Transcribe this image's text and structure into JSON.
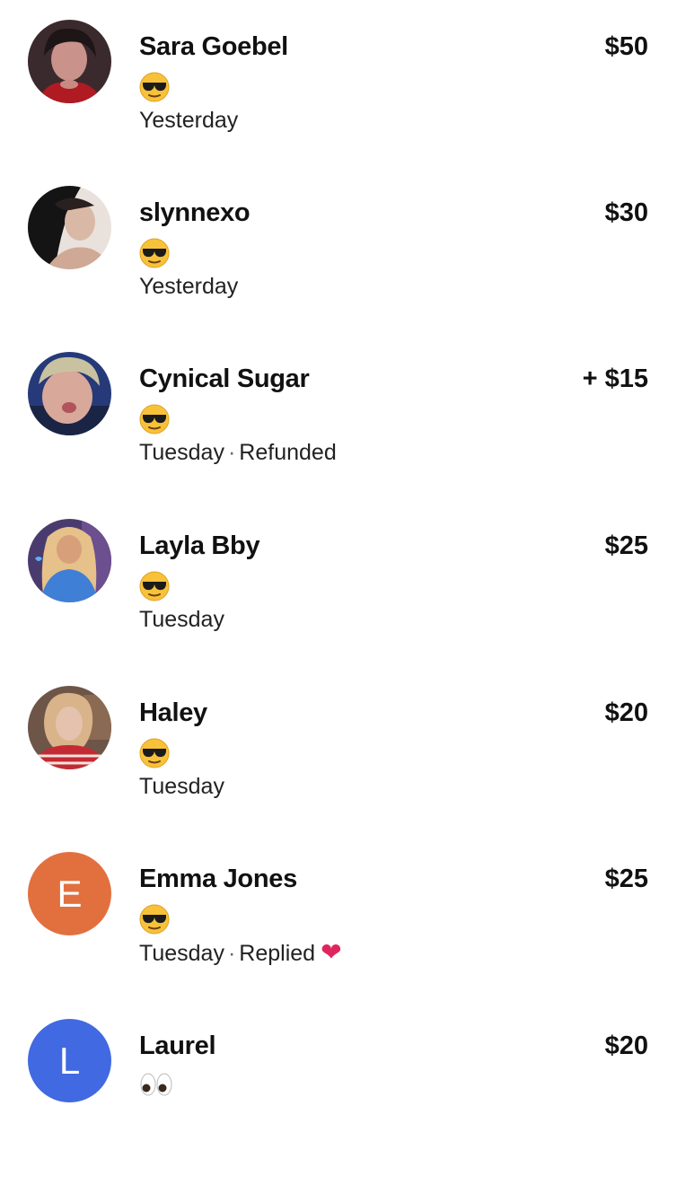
{
  "transactions": [
    {
      "name": "Sara Goebel",
      "emoji": "sunglasses-face-emoji",
      "date": "Yesterday",
      "status": "",
      "amount": "$50",
      "avatar_type": "photo",
      "avatar_colors": [
        "#3a2a2e",
        "#c9928a",
        "#b01a22"
      ]
    },
    {
      "name": "slynnexo",
      "emoji": "sunglasses-face-emoji",
      "date": "Yesterday",
      "status": "",
      "amount": "$30",
      "avatar_type": "photo",
      "avatar_colors": [
        "#141414",
        "#d9b9a6",
        "#2b2020"
      ]
    },
    {
      "name": "Cynical Sugar",
      "emoji": "sunglasses-face-emoji",
      "date": "Tuesday",
      "status": "Refunded",
      "amount": "+ $15",
      "avatar_type": "photo",
      "avatar_colors": [
        "#263a7a",
        "#d8a89a",
        "#c9c2a0"
      ]
    },
    {
      "name": "Layla Bby",
      "emoji": "sunglasses-face-emoji",
      "date": "Tuesday",
      "status": "",
      "amount": "$25",
      "avatar_type": "photo",
      "avatar_colors": [
        "#4a3b6e",
        "#3f7fd6",
        "#e6c18a"
      ]
    },
    {
      "name": "Haley",
      "emoji": "sunglasses-face-emoji",
      "date": "Tuesday",
      "status": "",
      "amount": "$20",
      "avatar_type": "photo",
      "avatar_colors": [
        "#6d5548",
        "#e4c2ae",
        "#c42a34"
      ]
    },
    {
      "name": "Emma Jones",
      "emoji": "sunglasses-face-emoji",
      "date": "Tuesday",
      "status": "Replied",
      "reaction": "red-heart-emoji",
      "amount": "$25",
      "avatar_type": "letter",
      "avatar_letter": "E",
      "avatar_bg": "#e2703f"
    },
    {
      "name": "Laurel",
      "emoji": "eyes-emoji",
      "date": "",
      "status": "",
      "amount": "$20",
      "avatar_type": "letter",
      "avatar_letter": "L",
      "avatar_bg": "#4169e1"
    }
  ],
  "colors": {
    "text": "#111111",
    "secondary_text": "#222222",
    "heart": "#e0245e"
  }
}
